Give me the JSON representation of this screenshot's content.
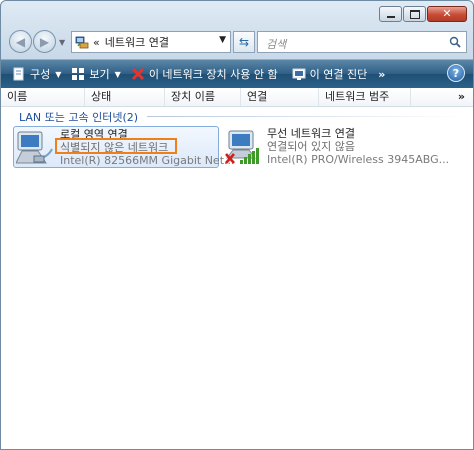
{
  "address": {
    "chevron": "«",
    "path": "네트워크 연결"
  },
  "search": {
    "placeholder": "검색"
  },
  "toolbar": {
    "organize_label": "구성",
    "views_label": "보기",
    "disable_label": "이 네트워크 장치 사용 안 함",
    "diagnose_label": "이 연결 진단",
    "more_label": "»",
    "help_label": "?"
  },
  "columns": [
    "이름",
    "상태",
    "장치 이름",
    "연결",
    "네트워크 범주"
  ],
  "columns_more": "»",
  "group": {
    "title": "LAN 또는 고속 인터넷(2)"
  },
  "connections": [
    {
      "name": "로컬 영역 연결",
      "status": "식별되지 않은 네트워크",
      "adapter": "Intel(R) 82566MM Gigabit Net...",
      "icon": "wired-network-icon",
      "selected": true
    },
    {
      "name": "무선 네트워크 연결",
      "status": "연결되어 있지 않음",
      "adapter": "Intel(R) PRO/Wireless 3945ABG...",
      "icon": "wireless-network-icon",
      "selected": false
    }
  ],
  "colors": {
    "toolbar": "#2e5f86",
    "selection_border": "#84acdd",
    "highlight_box": "#f07f1a",
    "group_text": "#1e4e9c",
    "disconnected_x": "#d0201a",
    "signal_bars": "#3f9a2a"
  }
}
